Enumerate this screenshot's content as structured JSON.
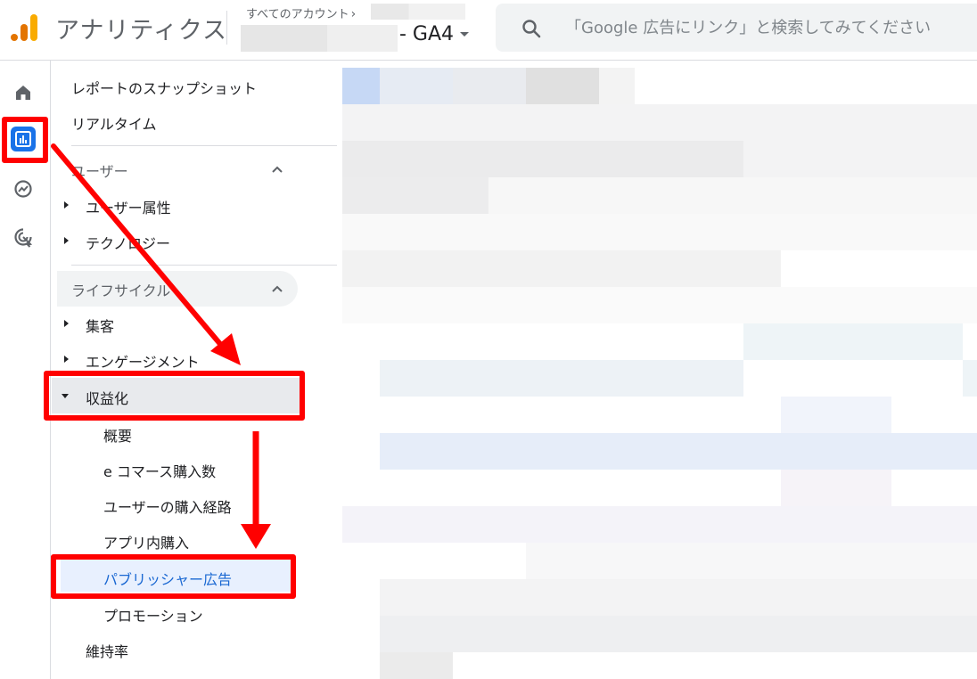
{
  "header": {
    "app_title": "アナリティクス",
    "account_breadcrumb": "すべてのアカウント",
    "property_name": "- GA4",
    "search_placeholder": "「Google 広告にリンク」と検索してみてください"
  },
  "rail": {
    "items": [
      {
        "name": "home",
        "icon": "home-icon"
      },
      {
        "name": "reports",
        "icon": "bar-chart-icon",
        "active": true
      },
      {
        "name": "explore",
        "icon": "explore-icon"
      },
      {
        "name": "advertising",
        "icon": "advertising-icon"
      }
    ]
  },
  "sidebar": {
    "snapshot": "レポートのスナップショット",
    "realtime": "リアルタイム",
    "user_section": "ユーザー",
    "user_attributes": "ユーザー属性",
    "technology": "テクノロジー",
    "lifecycle_section": "ライフサイクル",
    "acquisition": "集客",
    "engagement": "エンゲージメント",
    "monetization": "収益化",
    "monetization_items": [
      "概要",
      "e コマース購入数",
      "ユーザーの購入経路",
      "アプリ内購入",
      "パブリッシャー広告",
      "プロモーション"
    ],
    "retention": "維持率"
  },
  "colors": {
    "accent_blue": "#1a73e8",
    "annotation_red": "#ff0000",
    "active_text": "#1967d2"
  }
}
